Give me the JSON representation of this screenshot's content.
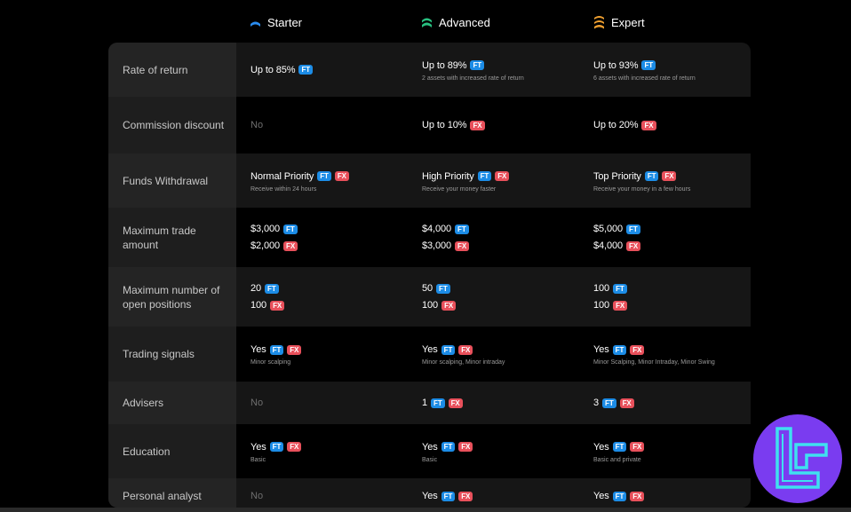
{
  "tiers": [
    {
      "name": "Starter",
      "icon": "starter-tier-icon"
    },
    {
      "name": "Advanced",
      "icon": "advanced-tier-icon"
    },
    {
      "name": "Expert",
      "icon": "expert-tier-icon"
    }
  ],
  "badge_labels": {
    "ft": "FT",
    "fx": "FX"
  },
  "colors": {
    "ft_badge": "#1c8ce6",
    "fx_badge": "#e8505b",
    "starter": "#2a8cf0",
    "advanced": "#28c080",
    "expert": "#f0a030",
    "logo": "#7a3cf0",
    "logo_accent": "#3fe0f0"
  },
  "rows": [
    {
      "label": "Rate of return",
      "cells": [
        {
          "lines": [
            {
              "text": "Up to 85%",
              "badges": [
                "ft"
              ]
            }
          ],
          "sub": ""
        },
        {
          "lines": [
            {
              "text": "Up to 89%",
              "badges": [
                "ft"
              ]
            }
          ],
          "sub": "2 assets with increased rate of return"
        },
        {
          "lines": [
            {
              "text": "Up to 93%",
              "badges": [
                "ft"
              ]
            }
          ],
          "sub": "6 assets with increased rate of return"
        }
      ]
    },
    {
      "label": "Commission discount",
      "cells": [
        {
          "no": "No"
        },
        {
          "lines": [
            {
              "text": "Up to 10%",
              "badges": [
                "fx"
              ]
            }
          ],
          "sub": ""
        },
        {
          "lines": [
            {
              "text": "Up to 20%",
              "badges": [
                "fx"
              ]
            }
          ],
          "sub": ""
        }
      ]
    },
    {
      "label": "Funds Withdrawal",
      "cells": [
        {
          "lines": [
            {
              "text": "Normal Priority",
              "badges": [
                "ft",
                "fx"
              ]
            }
          ],
          "sub": "Receive within 24 hours"
        },
        {
          "lines": [
            {
              "text": "High Priority",
              "badges": [
                "ft",
                "fx"
              ]
            }
          ],
          "sub": "Receive your money faster"
        },
        {
          "lines": [
            {
              "text": "Top Priority",
              "badges": [
                "ft",
                "fx"
              ]
            }
          ],
          "sub": "Receive your money in a few hours"
        }
      ]
    },
    {
      "label": "Maximum trade amount",
      "cells": [
        {
          "lines": [
            {
              "text": "$3,000",
              "badges": [
                "ft"
              ]
            },
            {
              "text": "$2,000",
              "badges": [
                "fx"
              ]
            }
          ],
          "sub": ""
        },
        {
          "lines": [
            {
              "text": "$4,000",
              "badges": [
                "ft"
              ]
            },
            {
              "text": "$3,000",
              "badges": [
                "fx"
              ]
            }
          ],
          "sub": ""
        },
        {
          "lines": [
            {
              "text": "$5,000",
              "badges": [
                "ft"
              ]
            },
            {
              "text": "$4,000",
              "badges": [
                "fx"
              ]
            }
          ],
          "sub": ""
        }
      ]
    },
    {
      "label": "Maximum number of open positions",
      "cells": [
        {
          "lines": [
            {
              "text": "20",
              "badges": [
                "ft"
              ]
            },
            {
              "text": "100",
              "badges": [
                "fx"
              ]
            }
          ],
          "sub": ""
        },
        {
          "lines": [
            {
              "text": "50",
              "badges": [
                "ft"
              ]
            },
            {
              "text": "100",
              "badges": [
                "fx"
              ]
            }
          ],
          "sub": ""
        },
        {
          "lines": [
            {
              "text": "100",
              "badges": [
                "ft"
              ]
            },
            {
              "text": "100",
              "badges": [
                "fx"
              ]
            }
          ],
          "sub": ""
        }
      ]
    },
    {
      "label": "Trading signals",
      "cells": [
        {
          "lines": [
            {
              "text": "Yes",
              "badges": [
                "ft",
                "fx"
              ]
            }
          ],
          "sub": "Minor scalping"
        },
        {
          "lines": [
            {
              "text": "Yes",
              "badges": [
                "ft",
                "fx"
              ]
            }
          ],
          "sub": "Minor scalping, Minor intraday"
        },
        {
          "lines": [
            {
              "text": "Yes",
              "badges": [
                "ft",
                "fx"
              ]
            }
          ],
          "sub": "Minor Scalping, Minor Intraday, Minor Swing"
        }
      ]
    },
    {
      "label": "Advisers",
      "cells": [
        {
          "no": "No"
        },
        {
          "lines": [
            {
              "text": "1",
              "badges": [
                "ft",
                "fx"
              ]
            }
          ],
          "sub": ""
        },
        {
          "lines": [
            {
              "text": "3",
              "badges": [
                "ft",
                "fx"
              ]
            }
          ],
          "sub": ""
        }
      ]
    },
    {
      "label": "Education",
      "cells": [
        {
          "lines": [
            {
              "text": "Yes",
              "badges": [
                "ft",
                "fx"
              ]
            }
          ],
          "sub": "Basic"
        },
        {
          "lines": [
            {
              "text": "Yes",
              "badges": [
                "ft",
                "fx"
              ]
            }
          ],
          "sub": "Basic"
        },
        {
          "lines": [
            {
              "text": "Yes",
              "badges": [
                "ft",
                "fx"
              ]
            }
          ],
          "sub": "Basic and private"
        }
      ]
    },
    {
      "label": "Personal analyst",
      "cells": [
        {
          "no": "No"
        },
        {
          "lines": [
            {
              "text": "Yes",
              "badges": [
                "ft",
                "fx"
              ]
            }
          ],
          "sub": ""
        },
        {
          "lines": [
            {
              "text": "Yes",
              "badges": [
                "ft",
                "fx"
              ]
            }
          ],
          "sub": ""
        }
      ]
    }
  ]
}
